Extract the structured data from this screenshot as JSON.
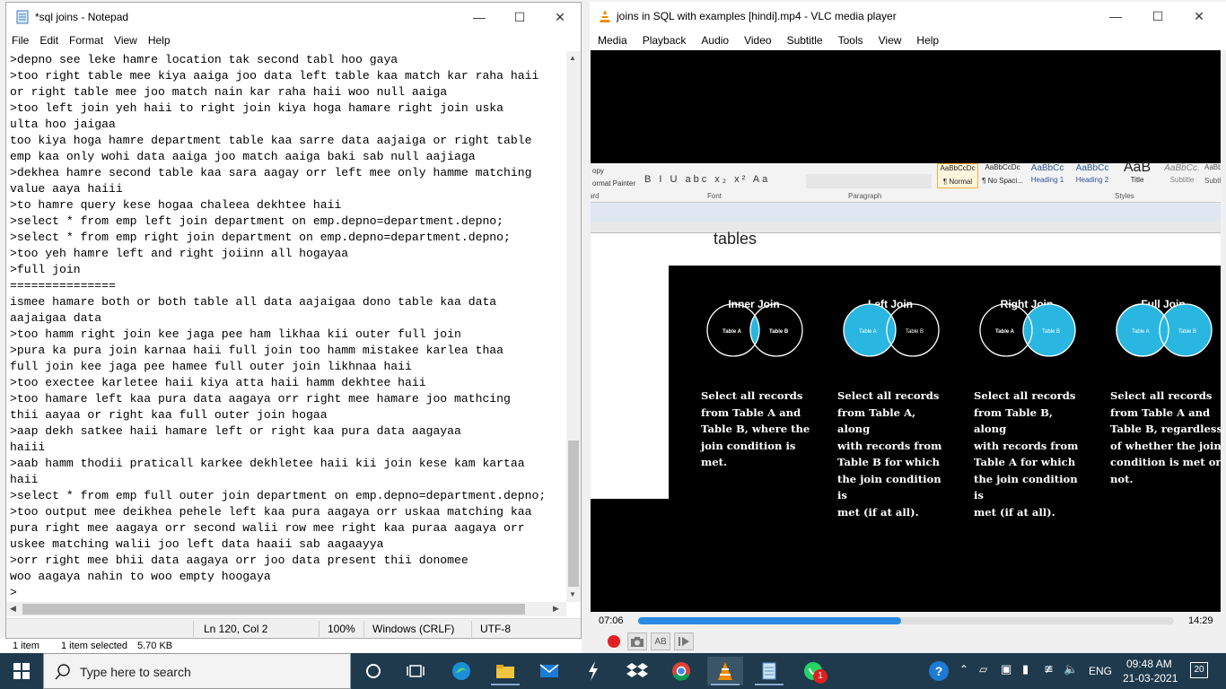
{
  "notepad": {
    "title": "*sql joins - Notepad",
    "menu": [
      "File",
      "Edit",
      "Format",
      "View",
      "Help"
    ],
    "lines": [
      ">depno see leke hamre location tak second tabl hoo gaya",
      ">too right table mee kiya aaiga joo data left table kaa match kar raha haii",
      "or right table mee joo match nain kar raha haii woo null aaiga",
      ">too left join yeh haii to right join kiya hoga hamare right join uska",
      "ulta hoo jaigaa",
      "too kiya hoga hamre department table kaa sarre data aajaiga or right table",
      "emp kaa only wohi data aaiga joo match aaiga baki sab null aajiaga",
      ">dekhea hamre second table kaa sara aagay orr left mee only hamme matching",
      "value aaya haiii",
      ">to hamre query kese hogaa chaleea dekhtee haii",
      ">select * from emp left join department on emp.depno=department.depno;",
      ">select * from emp right join department on emp.depno=department.depno;",
      ">too yeh hamre left and right joiinn all hogayaa",
      ">full join",
      "===============",
      "ismee hamare both or both table all data aajaigaa dono table kaa data",
      "aajaigaa data",
      ">too hamm right join kee jaga pee ham likhaa kii outer full join",
      ">pura ka pura join karnaa haii full join too hamm mistakee karlea thaa",
      "full join kee jaga pee hamee full outer join likhnaa haii",
      ">too exectee karletee haii kiya atta haii hamm dekhtee haii",
      ">too hamare left kaa pura data aagaya orr right mee hamare joo mathcing",
      "thii aayaa or right kaa full outer join hogaa",
      ">aap dekh satkee haii hamare left or right kaa pura data aagayaa",
      "haiii",
      ">aab hamm thodii praticall karkee dekhletee haii kii join kese kam kartaa",
      "haii",
      ">select * from emp full outer join department on emp.depno=department.depno;",
      ">too output mee deikhea pehele left kaa pura aagaya orr uskaa matching kaa",
      "pura right mee aagaya orr second walii row mee right kaa puraa aagaya orr",
      "uskee matching walii joo left data haaii sab aagaayya",
      ">orr right mee bhii data aagaya orr joo data present thii donomee",
      "woo aagaya nahin to woo empty hoogaya",
      ">"
    ],
    "status": {
      "position": "Ln 120, Col 2",
      "zoom": "100%",
      "line_ending": "Windows (CRLF)",
      "encoding": "UTF-8"
    }
  },
  "explorer_status": {
    "items": "1 item",
    "selected": "1 item selected",
    "size": "5.70 KB"
  },
  "vlc": {
    "title": "joins in SQL with examples [hindi].mp4 - VLC media player",
    "menu": [
      "Media",
      "Playback",
      "Audio",
      "Video",
      "Subtitle",
      "Tools",
      "View",
      "Help"
    ],
    "time_elapsed": "07:06",
    "time_total": "14:29",
    "progress": 0.49,
    "video": {
      "word_styles": [
        "AaBbCcDc",
        "AaBbCcDc",
        "AaBbCc",
        "AaBbCc",
        "AaB",
        "AaBbCc.",
        "AaBbCc"
      ],
      "word_style_names": [
        "¶ Normal",
        "¶ No Spaci...",
        "Heading 1",
        "Heading 2",
        "Title",
        "Subtitle",
        "Subtl"
      ],
      "ribbon_groups": [
        "Font",
        "Paragraph",
        "Styles"
      ],
      "clipboard": [
        "opy",
        "ormat Painter",
        "ard"
      ],
      "doc_text": "tables",
      "joins": [
        {
          "title": "Inner Join",
          "desc": "Select all records\nfrom Table A and\nTable B, where the\njoin condition is\nmet."
        },
        {
          "title": "Left Join",
          "desc": "Select all records\nfrom Table A, along\nwith records from\nTable B for which\nthe join condition is\nmet (if at all)."
        },
        {
          "title": "Right Join",
          "desc": "Select all records\nfrom Table B, along\nwith records from\nTable A for which\nthe join condition is\nmet (if at all)."
        },
        {
          "title": "Full Join",
          "desc": "Select all records\nfrom Table A and\nTable B, regardless\nof whether the join\ncondition is met or\nnot."
        }
      ],
      "table_a": "Table A",
      "table_b": "Table B"
    }
  },
  "taskbar": {
    "search_placeholder": "Type here to search",
    "time": "09:48 AM",
    "date": "21-03-2021",
    "language": "ENG",
    "notifications": "20",
    "whatsapp_badge": "1"
  },
  "colors": {
    "venn_fill": "#29b6e0",
    "taskbar": "#1e3a4c",
    "vlc_seek": "#2b8ae3"
  }
}
